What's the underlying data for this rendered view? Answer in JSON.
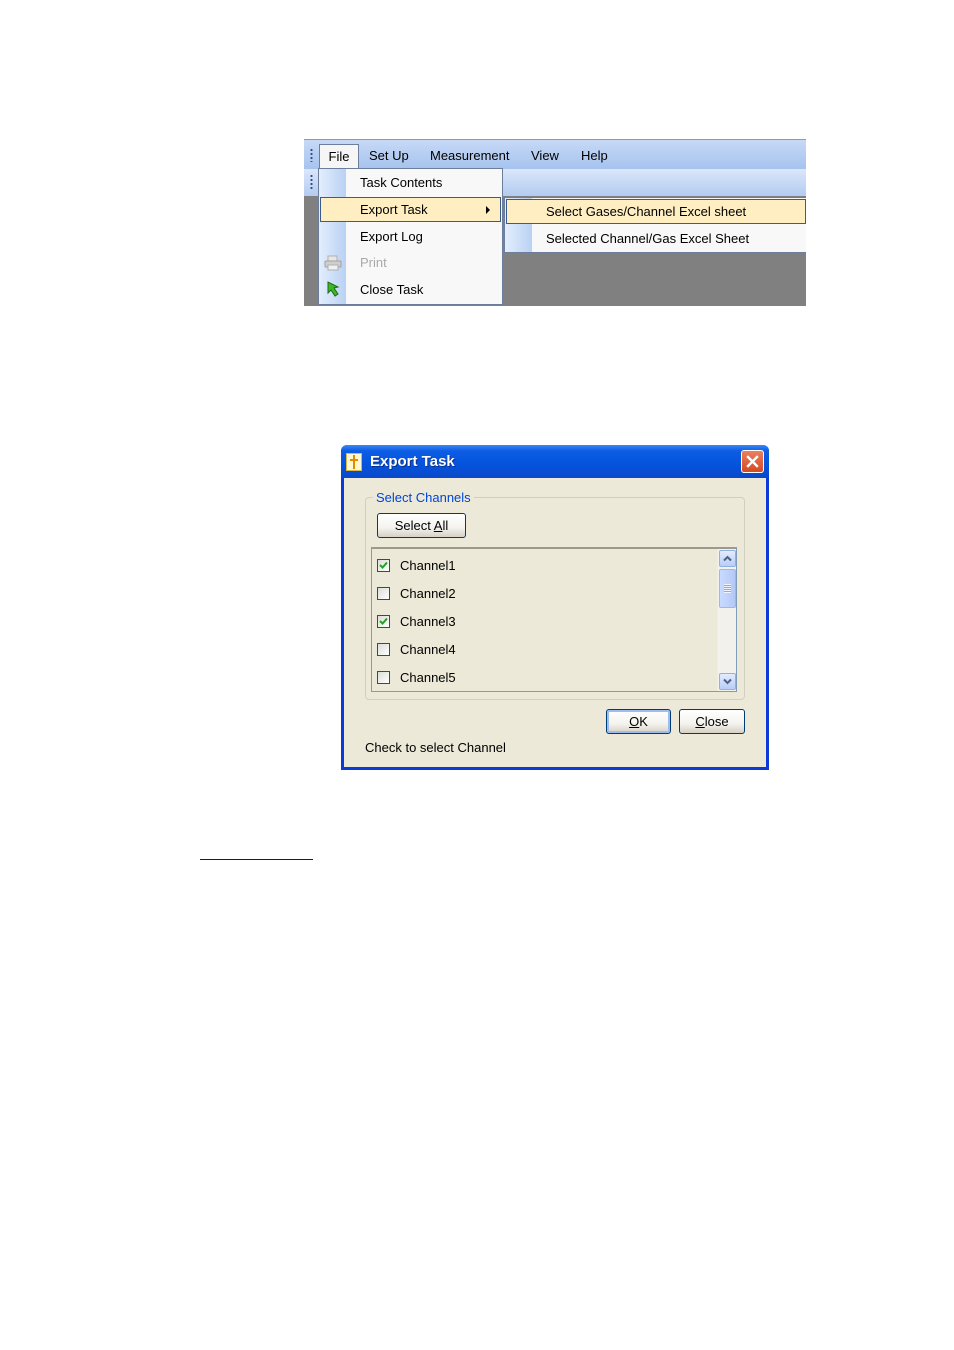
{
  "menu_screenshot": {
    "menubar": {
      "items": [
        {
          "label": "File"
        },
        {
          "label": "Set Up"
        },
        {
          "label": "Measurement"
        },
        {
          "label": "View"
        },
        {
          "label": "Help"
        }
      ]
    },
    "file_menu": {
      "items": [
        {
          "label": "Task Contents"
        },
        {
          "label": "Export Task",
          "has_submenu": true,
          "highlighted": true
        },
        {
          "label": "Export Log"
        },
        {
          "label": "Print",
          "disabled": true,
          "icon": "printer-icon"
        },
        {
          "label": "Close Task",
          "icon": "green-arrow-icon"
        }
      ]
    },
    "export_submenu": {
      "items": [
        {
          "label": "Select Gases/Channel Excel sheet",
          "highlighted": true
        },
        {
          "label": "Selected Channel/Gas Excel Sheet"
        }
      ]
    },
    "colors": {
      "highlight": "#ffeec2",
      "menubar": "#a6c3ee",
      "background": "#808080"
    }
  },
  "export_dialog": {
    "title": "Export Task",
    "group_label": "Select Channels",
    "select_all": {
      "pre": "Select ",
      "accel": "A",
      "post": "ll"
    },
    "channels": [
      {
        "label": "Channel1",
        "checked": true
      },
      {
        "label": "Channel2",
        "checked": false
      },
      {
        "label": "Channel3",
        "checked": true
      },
      {
        "label": "Channel4",
        "checked": false
      },
      {
        "label": "Channel5",
        "checked": false
      }
    ],
    "ok_button": {
      "accel": "O",
      "post": "K"
    },
    "close_button": {
      "accel": "C",
      "post": "lose"
    },
    "status": "Check to select Channel",
    "colors": {
      "titlebar": "#0553dd",
      "client": "#ece9d8",
      "group_label": "#0046d5",
      "check": "#21a121"
    }
  }
}
